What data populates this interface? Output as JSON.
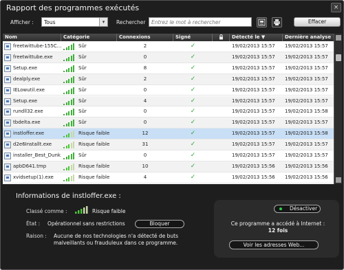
{
  "window": {
    "title": "Rapport des programmes exécutés",
    "close_label": "×"
  },
  "toolbar": {
    "show_label": "Afficher :",
    "show_value": "Tous",
    "search_label": "Rechercher",
    "search_placeholder": "Entrez le mot à rechercher",
    "clear_label": "Effacer"
  },
  "table": {
    "headers": [
      "Nom",
      "Catégorie",
      "Connexions",
      "Signé",
      "",
      "Détecté le ▼",
      "Dernière analyse"
    ],
    "rows": [
      {
        "name": "freetwittube-155C...",
        "category": "Sûr",
        "connexions": "2",
        "signed": "✓",
        "detected": "19/02/2013 15:57",
        "last": "19/02/2013 15:57"
      },
      {
        "name": "freetwittube.exe",
        "category": "Sûr",
        "connexions": "0",
        "signed": "✓",
        "detected": "19/02/2013 15:57",
        "last": "19/02/2013 15:57"
      },
      {
        "name": "Setup.exe",
        "category": "Sûr",
        "connexions": "8",
        "signed": "✓",
        "detected": "19/02/2013 15:57",
        "last": "19/02/2013 15:57"
      },
      {
        "name": "dealply.exe",
        "category": "Sûr",
        "connexions": "2",
        "signed": "✓",
        "detected": "19/02/2013 15:57",
        "last": "19/02/2013 15:57"
      },
      {
        "name": "IELowutil.exe",
        "category": "Sûr",
        "connexions": "0",
        "signed": "✓",
        "detected": "19/02/2013 15:57",
        "last": "19/02/2013 15:57"
      },
      {
        "name": "Setup.exe",
        "category": "Sûr",
        "connexions": "4",
        "signed": "✓",
        "detected": "19/02/2013 15:57",
        "last": "19/02/2013 15:57"
      },
      {
        "name": "rundll32.exe",
        "category": "Sûr",
        "connexions": "0",
        "signed": "✓",
        "detected": "19/02/2013 15:57",
        "last": "19/02/2013 15:58"
      },
      {
        "name": "tbdelta.exe",
        "category": "Sûr",
        "connexions": "0",
        "signed": "✓",
        "detected": "19/02/2013 15:57",
        "last": "19/02/2013 15:57"
      },
      {
        "name": "instloffer.exe",
        "category": "Risque faible",
        "connexions": "12",
        "signed": "✓",
        "detected": "19/02/2013 15:57",
        "last": "19/02/2013 15:58",
        "selected": true
      },
      {
        "name": "d2e6Installt.exe",
        "category": "Risque faible",
        "connexions": "31",
        "signed": "✓",
        "detected": "19/02/2013 15:57",
        "last": "19/02/2013 15:57"
      },
      {
        "name": "installer_Best_Dunk...",
        "category": "Sûr",
        "connexions": "0",
        "signed": "✓",
        "detected": "19/02/2013 15:57",
        "last": "19/02/2013 15:57"
      },
      {
        "name": "apbD641.tmp",
        "category": "Risque faible",
        "connexions": "10",
        "signed": "✓",
        "detected": "19/02/2013 15:56",
        "last": "19/02/2013 15:56"
      },
      {
        "name": "xvidsetup(1).exe",
        "category": "Risque faible",
        "connexions": "4",
        "signed": "✓",
        "detected": "19/02/2013 15:56",
        "last": "19/02/2013 15:56"
      }
    ]
  },
  "info": {
    "title": "Informations de instloffer.exe :",
    "classified_label": "Classé comme :",
    "classified_value": "Risque faible",
    "state_label": "État :",
    "state_value": "Opérationnel sans restrictions",
    "block_label": "Bloquer",
    "reason_label": "Raison :",
    "reason_line1": "Aucune de nos technologies n'a détecté de buts",
    "reason_line2": "malveillants ou frauduleux dans ce programme.",
    "deactivate_label": "Désactiver",
    "internet_line": "Ce programme a accédé à Internet :",
    "internet_count": "12 fois",
    "addresses_label": "Voir les adresses Web..."
  },
  "colors": {
    "safe_bar": "#3fb03a",
    "risk_bar_active": "#4cc43a",
    "risk_bar_inactive": "#c7d8a8",
    "selected_row": "#c8dff6",
    "check": "#2fa336"
  }
}
